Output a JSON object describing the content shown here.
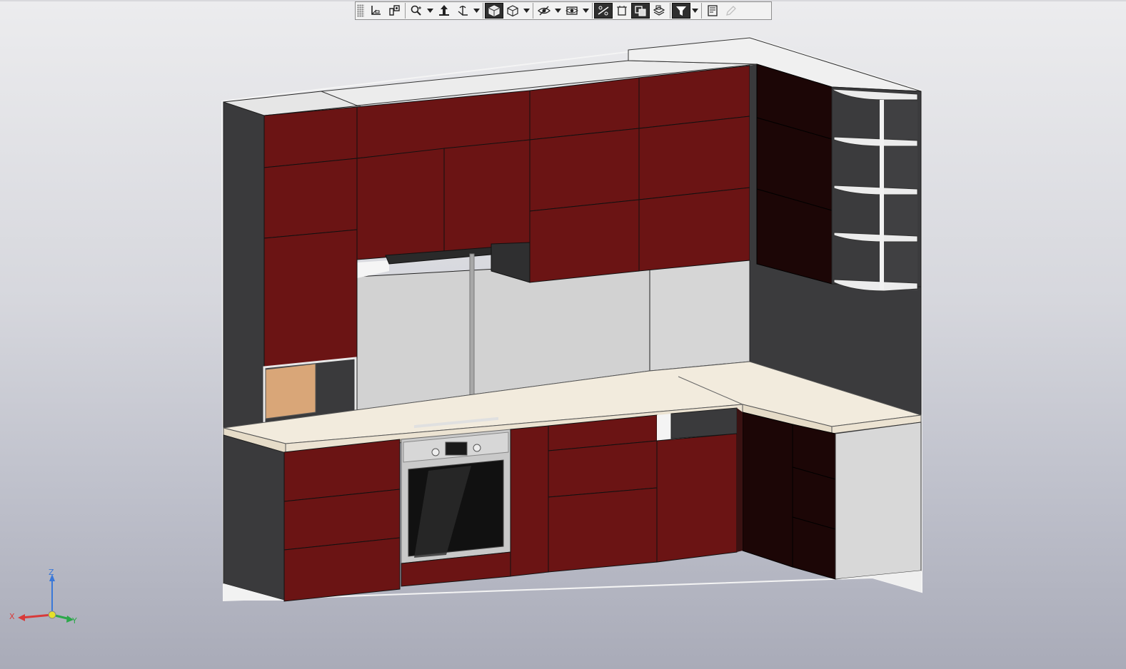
{
  "toolbar": {
    "buttons": [
      {
        "name": "local-coordinate-system-icon",
        "active": false
      },
      {
        "name": "orientation-icon",
        "active": false
      },
      {
        "name": "zoom-icon",
        "active": false,
        "dropdown": true
      },
      {
        "name": "pan-icon",
        "active": false
      },
      {
        "name": "rotate-icon",
        "active": false,
        "dropdown": true
      },
      {
        "name": "shaded-view-icon",
        "active": true
      },
      {
        "name": "wireframe-view-icon",
        "active": false,
        "dropdown": true
      },
      {
        "name": "hidden-lines-icon",
        "active": false,
        "dropdown": true
      },
      {
        "name": "perspective-icon",
        "active": false,
        "dropdown": true
      },
      {
        "name": "section-icon",
        "active": true
      },
      {
        "name": "display-mode-icon",
        "active": false
      },
      {
        "name": "component-view-icon",
        "active": true
      },
      {
        "name": "layer-view-icon",
        "active": false
      },
      {
        "name": "filter-icon",
        "active": true,
        "dropdown": true
      },
      {
        "name": "properties-icon",
        "active": false
      },
      {
        "name": "edit-pencil-icon",
        "active": false,
        "disabled": true
      }
    ]
  },
  "triad": {
    "x_label": "X",
    "y_label": "Y",
    "z_label": "Z"
  },
  "colors": {
    "front": "#6b1414",
    "front_dark": "#1c0606",
    "carcass": "#3a3a3c",
    "light_panel": "#d4d4d4",
    "countertop": "#f2ebdd",
    "accent_wood": "#d9a678",
    "steel": "#c8c8c8"
  }
}
